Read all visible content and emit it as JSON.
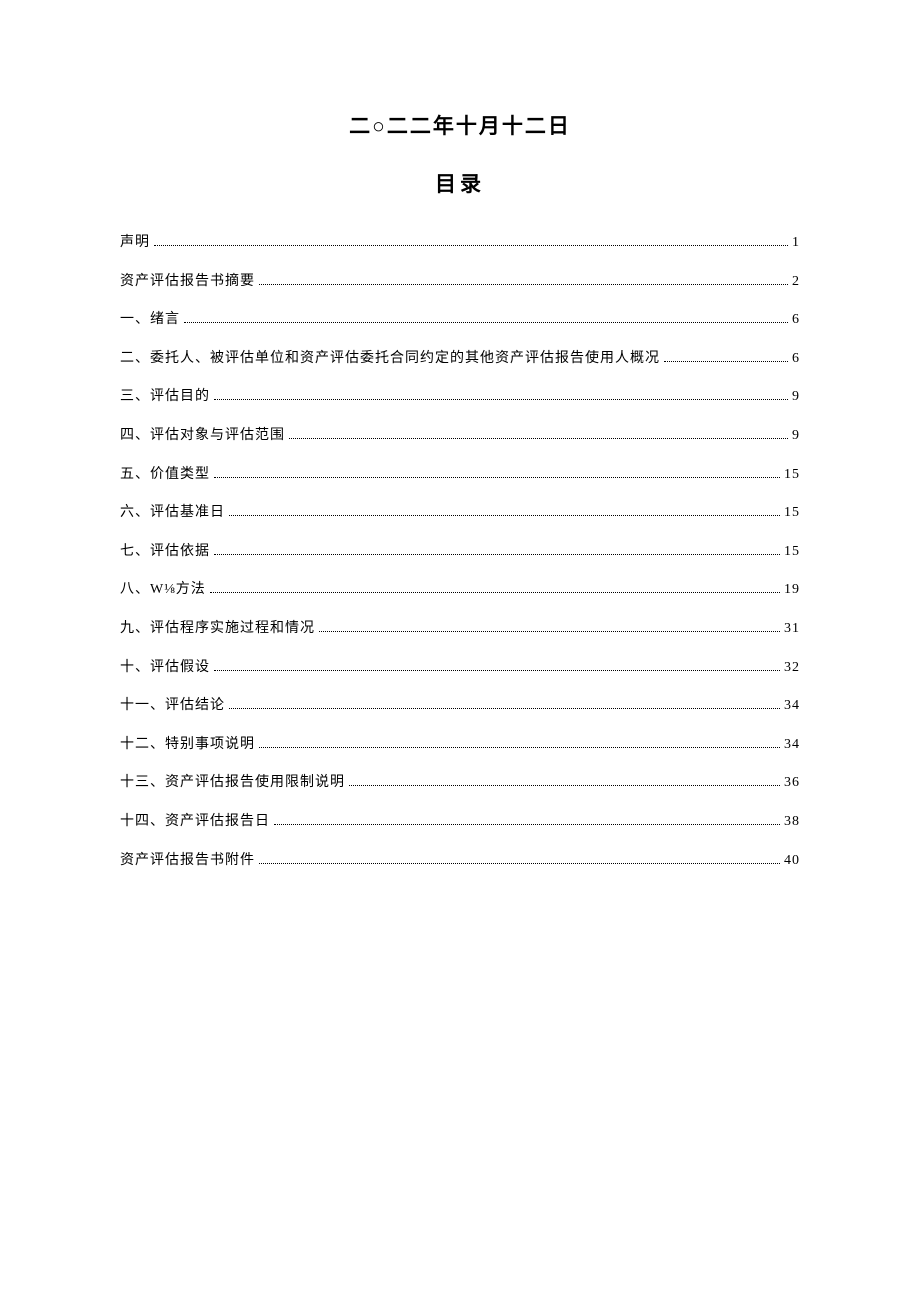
{
  "date_line": "二○二二年十月十二日",
  "toc_title": "目录",
  "toc": [
    {
      "label": "声明",
      "page": "1"
    },
    {
      "label": "资产评估报告书摘要",
      "page": "2"
    },
    {
      "label": "一、绪言",
      "page": "6"
    },
    {
      "label": "二、委托人、被评估单位和资产评估委托合同约定的其他资产评估报告使用人概况",
      "page": "6"
    },
    {
      "label": "三、评估目的",
      "page": "9"
    },
    {
      "label": "四、评估对象与评估范围",
      "page": "9"
    },
    {
      "label": "五、价值类型",
      "page": "15"
    },
    {
      "label": "六、评估基准日",
      "page": "15"
    },
    {
      "label": "七、评估依据",
      "page": "15"
    },
    {
      "label": "八、W⅛方法",
      "page": "19"
    },
    {
      "label": "九、评估程序实施过程和情况",
      "page": "31"
    },
    {
      "label": "十、评估假设",
      "page": "32"
    },
    {
      "label": "十一、评估结论",
      "page": "34"
    },
    {
      "label": "十二、特别事项说明",
      "page": "34"
    },
    {
      "label": "十三、资产评估报告使用限制说明",
      "page": "36"
    },
    {
      "label": "十四、资产评估报告日",
      "page": "38"
    },
    {
      "label": "资产评估报告书附件",
      "page": "40"
    }
  ]
}
